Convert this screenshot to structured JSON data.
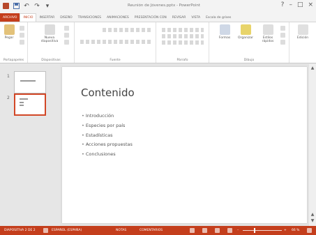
{
  "window": {
    "title": "Reunión de Jóvenes.pptx - PowerPoint",
    "controls": [
      "?",
      "–",
      "□",
      "×"
    ]
  },
  "qat": {
    "undo_glyph": "↶",
    "redo_glyph": "↷",
    "more_glyph": "▾"
  },
  "ribbon": {
    "tabs": [
      "ARCHIVO",
      "INICIO",
      "INSERTAR",
      "DISEÑO",
      "TRANSICIONES",
      "ANIMACIONES",
      "PRESENTACIÓN CON",
      "REVISAR",
      "VISTA",
      "Escala de grises"
    ],
    "active_tab_index": 1,
    "groups": {
      "clipboard": {
        "label": "Portapapeles",
        "paste_label": "Pegar"
      },
      "slides": {
        "label": "Diapositivas",
        "new_slide_label": "Nueva diapositiva"
      },
      "font": {
        "label": "Fuente"
      },
      "paragraph": {
        "label": "Párrafo"
      },
      "drawing": {
        "label": "Dibujo",
        "shapes_label": "Formas",
        "arrange_label": "Organizar",
        "quick_styles_label": "Estilos rápidos"
      },
      "editing": {
        "label": "Edición",
        "find_label": "Edición"
      }
    }
  },
  "thumbnails": [
    {
      "number": "1"
    },
    {
      "number": "2"
    }
  ],
  "slide": {
    "title": "Contenido",
    "bullets": [
      "Introducción",
      "Especies por país",
      "Estadísticas",
      "Acciones propuestas",
      "Conclusiones"
    ]
  },
  "status": {
    "slide_indicator": "DIAPOSITIVA 2 DE 2",
    "language": "ESPAÑOL (ESPAÑA)",
    "notes_label": "NOTAS",
    "comments_label": "COMENTARIOS",
    "zoom": "66 %",
    "zoom_percent": 66
  },
  "colors": {
    "accent": "#c43e1c",
    "thumb_selected": "#d24726"
  }
}
